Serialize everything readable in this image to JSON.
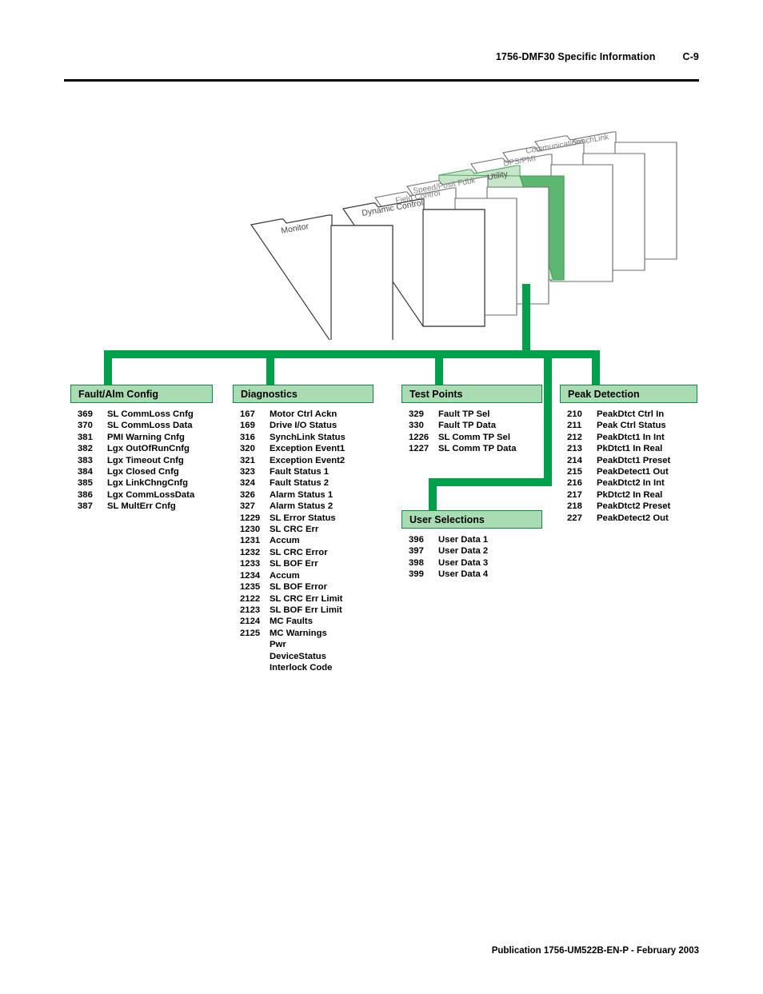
{
  "header": {
    "title": "1756-DMF30 Specific Information",
    "page": "C-9"
  },
  "footer": {
    "text": "Publication 1756-UM522B-EN-P - February 2003"
  },
  "colors": {
    "accent_green": "#00a14b",
    "folder_dark_green": "#5cb871",
    "folder_light_green": "#c8e6c9",
    "box_header_green": "#a9dcb2",
    "box_border_green": "#0e8a43"
  },
  "folder_stack": {
    "tabs": [
      {
        "label": "Monitor",
        "selected": false
      },
      {
        "label": "Dynamic Control",
        "selected": false
      },
      {
        "label": "Field Control",
        "selected": false
      },
      {
        "label": "Speed/Posit Fdbk",
        "selected": false
      },
      {
        "label": "Utility",
        "selected": true
      },
      {
        "label": "DPS/PMI",
        "selected": false
      },
      {
        "label": "Communications",
        "selected": false
      },
      {
        "label": "SynchLink",
        "selected": false
      }
    ]
  },
  "groups": [
    {
      "id": "fault",
      "title": "Fault/Alm Config",
      "params": [
        {
          "num": "369",
          "name": "SL CommLoss Cnfg"
        },
        {
          "num": "370",
          "name": "SL CommLoss Data"
        },
        {
          "num": "381",
          "name": "PMI Warning Cnfg"
        },
        {
          "num": "382",
          "name": "Lgx OutOfRunCnfg"
        },
        {
          "num": "383",
          "name": "Lgx Timeout Cnfg"
        },
        {
          "num": "384",
          "name": "Lgx Closed Cnfg"
        },
        {
          "num": "385",
          "name": "Lgx LinkChngCnfg"
        },
        {
          "num": "386",
          "name": "Lgx CommLossData"
        },
        {
          "num": "387",
          "name": "SL MultErr Cnfg"
        }
      ]
    },
    {
      "id": "diagnostics",
      "title": "Diagnostics",
      "params": [
        {
          "num": "167",
          "name": "Motor Ctrl Ackn"
        },
        {
          "num": "169",
          "name": "Drive I/O Status"
        },
        {
          "num": "316",
          "name": "SynchLink Status"
        },
        {
          "num": "320",
          "name": "Exception Event1"
        },
        {
          "num": "321",
          "name": "Exception Event2"
        },
        {
          "num": "323",
          "name": "Fault Status 1"
        },
        {
          "num": "324",
          "name": "Fault Status 2"
        },
        {
          "num": "326",
          "name": "Alarm Status 1"
        },
        {
          "num": "327",
          "name": "Alarm Status 2"
        },
        {
          "num": "1229",
          "name": "SL Error Status"
        },
        {
          "num": "1230",
          "name": "SL CRC Err"
        },
        {
          "num": "1231",
          "name": "Accum"
        },
        {
          "num": "1232",
          "name": "SL CRC Error"
        },
        {
          "num": "1233",
          "name": "SL BOF Err"
        },
        {
          "num": "1234",
          "name": "Accum"
        },
        {
          "num": "1235",
          "name": "SL BOF Error"
        },
        {
          "num": "2122",
          "name": "SL CRC Err Limit"
        },
        {
          "num": "2123",
          "name": "SL BOF Err Limit"
        },
        {
          "num": "2124",
          "name": "MC Faults"
        },
        {
          "num": "2125",
          "name": "MC Warnings"
        },
        {
          "num": "",
          "name": "Pwr"
        },
        {
          "num": "",
          "name": "DeviceStatus"
        },
        {
          "num": "",
          "name": "Interlock Code"
        }
      ]
    },
    {
      "id": "test_points",
      "title": "Test Points",
      "params": [
        {
          "num": "329",
          "name": "Fault TP Sel"
        },
        {
          "num": "330",
          "name": "Fault TP Data"
        },
        {
          "num": "1226",
          "name": "SL Comm TP Sel"
        },
        {
          "num": "1227",
          "name": "SL Comm TP Data"
        }
      ]
    },
    {
      "id": "peak_detection",
      "title": "Peak Detection",
      "params": [
        {
          "num": "210",
          "name": "PeakDtct Ctrl In"
        },
        {
          "num": "211",
          "name": "Peak Ctrl Status"
        },
        {
          "num": "212",
          "name": "PeakDtct1 In Int"
        },
        {
          "num": "213",
          "name": "PkDtct1 In Real"
        },
        {
          "num": "214",
          "name": "PeakDtct1 Preset"
        },
        {
          "num": "215",
          "name": "PeakDetect1 Out"
        },
        {
          "num": "216",
          "name": "PeakDtct2 In Int"
        },
        {
          "num": "217",
          "name": "PkDtct2 In Real"
        },
        {
          "num": "218",
          "name": "PeakDtct2 Preset"
        },
        {
          "num": "227",
          "name": "PeakDetect2 Out"
        }
      ]
    },
    {
      "id": "user_selections",
      "title": "User Selections",
      "params": [
        {
          "num": "396",
          "name": "User Data 1"
        },
        {
          "num": "397",
          "name": "User Data 2"
        },
        {
          "num": "398",
          "name": "User Data 3"
        },
        {
          "num": "399",
          "name": "User Data 4"
        }
      ]
    }
  ]
}
